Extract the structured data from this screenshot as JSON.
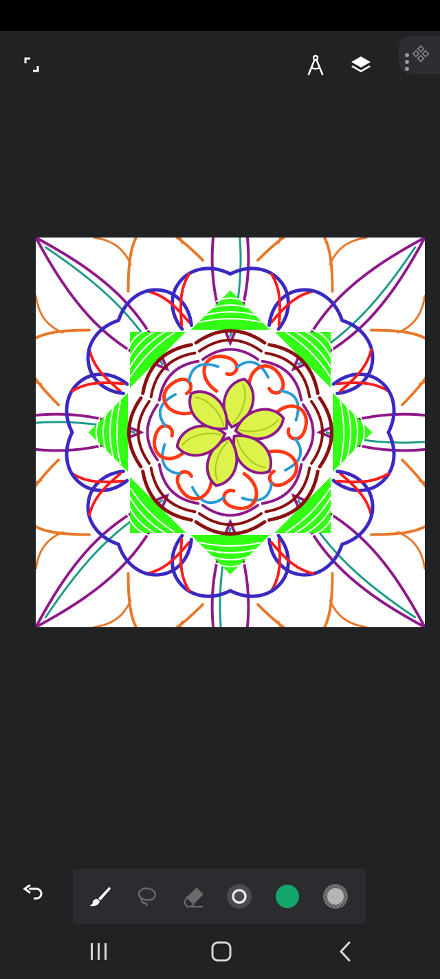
{
  "top_bar": {
    "fullscreen_icon": "fullscreen-icon",
    "ruler_icon": "compass-ruler-icon",
    "layers_icon": "layers-icon",
    "more_icon": "more-vertical-icon",
    "corner_icon": "diamond-grid-icon"
  },
  "canvas": {
    "background": "#ffffff",
    "symmetry_segments": 8
  },
  "toolbar": {
    "tools": [
      {
        "name": "brush-icon",
        "active": true
      },
      {
        "name": "lasso-icon",
        "active": false
      },
      {
        "name": "eraser-icon",
        "active": false
      },
      {
        "name": "brush-size-icon",
        "active": false
      },
      {
        "name": "color-swatch",
        "color": "#12a66a"
      },
      {
        "name": "opacity-icon",
        "active": false
      }
    ],
    "undo_icon": "undo-icon"
  },
  "system_nav": {
    "recents_icon": "recents-icon",
    "home_icon": "home-icon",
    "back_icon": "back-icon"
  },
  "colors": {
    "background": "#212224",
    "mandala": [
      "#8e1a8a",
      "#e8782a",
      "#1f9a8a",
      "#ff1c1c",
      "#3a2ac2",
      "#33ff14",
      "#8b1010",
      "#ff3a14",
      "#2a9ad8",
      "#ddf24a"
    ]
  }
}
